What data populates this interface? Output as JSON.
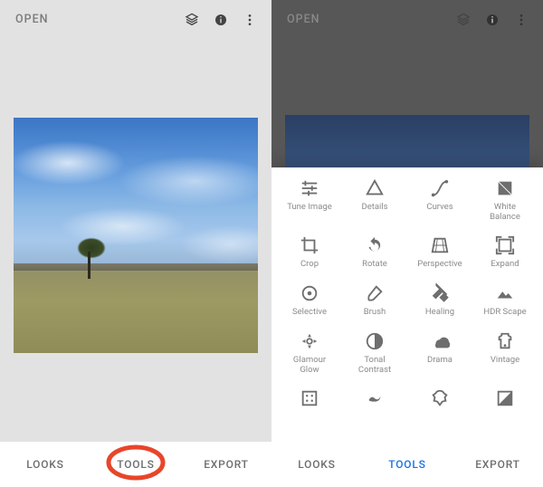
{
  "left": {
    "open_label": "OPEN",
    "tabs": {
      "looks": "LOOKS",
      "tools": "TOOLS",
      "export": "EXPORT"
    }
  },
  "right": {
    "open_label": "OPEN",
    "tabs": {
      "looks": "LOOKS",
      "tools": "TOOLS",
      "export": "EXPORT"
    },
    "tools": [
      {
        "id": "tune-image",
        "label": "Tune Image"
      },
      {
        "id": "details",
        "label": "Details"
      },
      {
        "id": "curves",
        "label": "Curves"
      },
      {
        "id": "white-balance",
        "label": "White\nBalance"
      },
      {
        "id": "crop",
        "label": "Crop"
      },
      {
        "id": "rotate",
        "label": "Rotate"
      },
      {
        "id": "perspective",
        "label": "Perspective"
      },
      {
        "id": "expand",
        "label": "Expand"
      },
      {
        "id": "selective",
        "label": "Selective"
      },
      {
        "id": "brush",
        "label": "Brush"
      },
      {
        "id": "healing",
        "label": "Healing"
      },
      {
        "id": "hdr-scape",
        "label": "HDR Scape"
      },
      {
        "id": "glamour-glow",
        "label": "Glamour\nGlow"
      },
      {
        "id": "tonal-contrast",
        "label": "Tonal\nContrast"
      },
      {
        "id": "drama",
        "label": "Drama"
      },
      {
        "id": "vintage",
        "label": "Vintage"
      },
      {
        "id": "grainy-film",
        "label": ""
      },
      {
        "id": "retrolux",
        "label": ""
      },
      {
        "id": "grunge",
        "label": ""
      },
      {
        "id": "black-white",
        "label": ""
      }
    ]
  },
  "annotation": {
    "circled_tab": "tools"
  }
}
